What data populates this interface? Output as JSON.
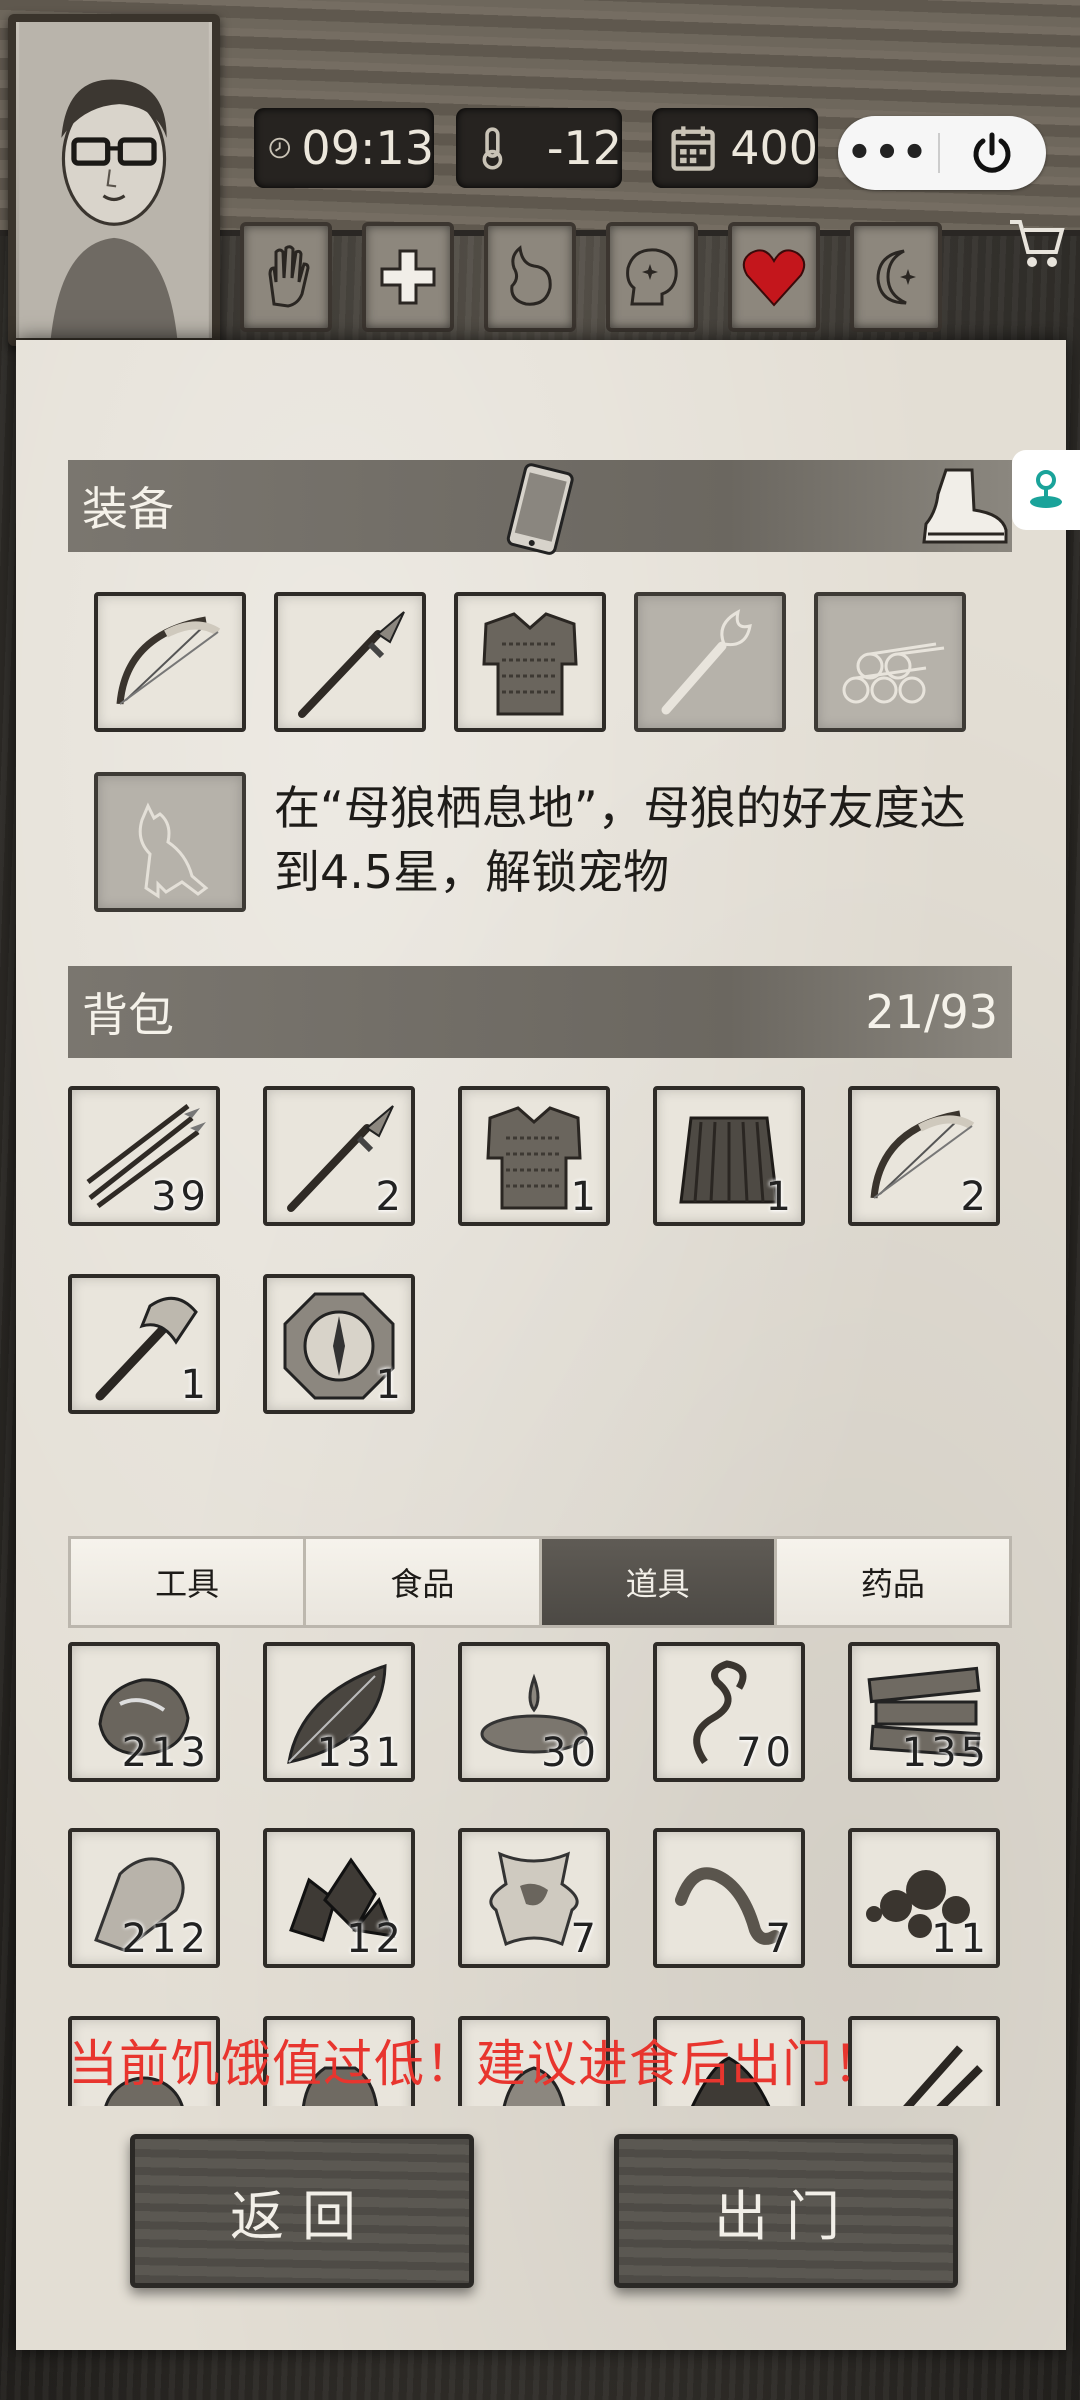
{
  "hud": {
    "time": "09:13",
    "temperature": "-12",
    "days": "400",
    "more_label": "•••"
  },
  "status_icons": [
    "hand-icon",
    "medical-cross-icon",
    "stomach-icon",
    "brain-icon",
    "heart-icon",
    "moon-icon"
  ],
  "colors": {
    "warning": "#e8352e",
    "heart": "#c4161c",
    "band": "#6b6760",
    "active_tab": "#4c4944"
  },
  "equipment": {
    "title": "装备",
    "slots": [
      {
        "name": "bow",
        "locked": false
      },
      {
        "name": "spear",
        "locked": false
      },
      {
        "name": "chainmail-vest",
        "locked": false
      },
      {
        "name": "torch",
        "locked": true
      },
      {
        "name": "logs",
        "locked": true
      }
    ],
    "pet_slot": {
      "name": "wolf",
      "locked": true
    },
    "pet_text": "在“母狼栖息地”，母狼的好友度达到4.5星，解锁宠物"
  },
  "backpack": {
    "title": "背包",
    "capacity": "21/93",
    "items": [
      {
        "name": "arrows",
        "count": "39"
      },
      {
        "name": "spear",
        "count": "2"
      },
      {
        "name": "chainmail-vest",
        "count": "1"
      },
      {
        "name": "grass-skirt",
        "count": "1"
      },
      {
        "name": "bow",
        "count": "2"
      },
      {
        "name": "axe",
        "count": "1"
      },
      {
        "name": "compass",
        "count": "1"
      }
    ]
  },
  "storage": {
    "tabs": [
      {
        "label": "工具",
        "active": false
      },
      {
        "label": "食品",
        "active": false
      },
      {
        "label": "道具",
        "active": true
      },
      {
        "label": "药品",
        "active": false
      }
    ],
    "items": [
      {
        "name": "stone",
        "count": "213"
      },
      {
        "name": "leaf",
        "count": "131"
      },
      {
        "name": "water",
        "count": "30"
      },
      {
        "name": "vine",
        "count": "70"
      },
      {
        "name": "wood-planks",
        "count": "135"
      },
      {
        "name": "flint",
        "count": "212"
      },
      {
        "name": "ore",
        "count": "12"
      },
      {
        "name": "animal-hide",
        "count": "7"
      },
      {
        "name": "worm",
        "count": "7"
      },
      {
        "name": "tar",
        "count": "11"
      }
    ],
    "partial_row": [
      "round-item",
      "sack",
      "shell",
      "rock-pile",
      "tools"
    ]
  },
  "warning": "当前饥饿值过低！建议进食后出门！",
  "buttons": {
    "back": "返回",
    "go_out": "出门"
  }
}
